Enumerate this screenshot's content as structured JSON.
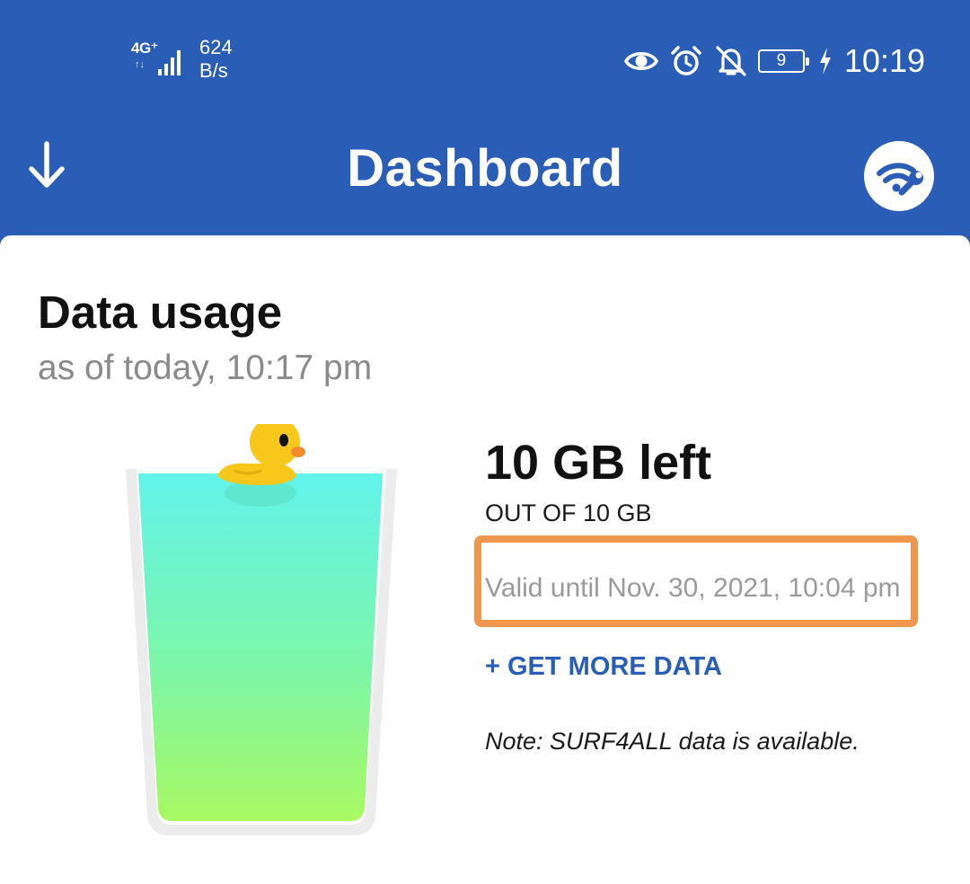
{
  "status_bar": {
    "network_type": "4G⁺",
    "net_arrows": "↑↓",
    "speed_value": "624",
    "speed_unit": "B/s",
    "battery_level": "9",
    "time": "10:19",
    "icons": [
      "eye-icon",
      "alarm-icon",
      "bell-off-icon",
      "battery-icon",
      "charging-icon"
    ]
  },
  "app_bar": {
    "title": "Dashboard",
    "back_icon": "arrow-down-icon",
    "tools_icon": "wifi-wrench-icon"
  },
  "data_usage": {
    "title": "Data usage",
    "subtitle": "as of today, 10:17 pm",
    "remaining": "10 GB left",
    "total": "OUT OF 10 GB",
    "validity": "Valid until Nov. 30, 2021, 10:04 pm",
    "get_more": "+ GET MORE DATA",
    "note": "Note: SURF4ALL data is available.",
    "fill_fraction": 1.0
  },
  "colors": {
    "brand_blue": "#2a5db6",
    "highlight_orange": "#f0974f",
    "liquid_top": "#62f3ec",
    "liquid_bottom": "#a9f962",
    "duck_yellow": "#f7c71c"
  }
}
